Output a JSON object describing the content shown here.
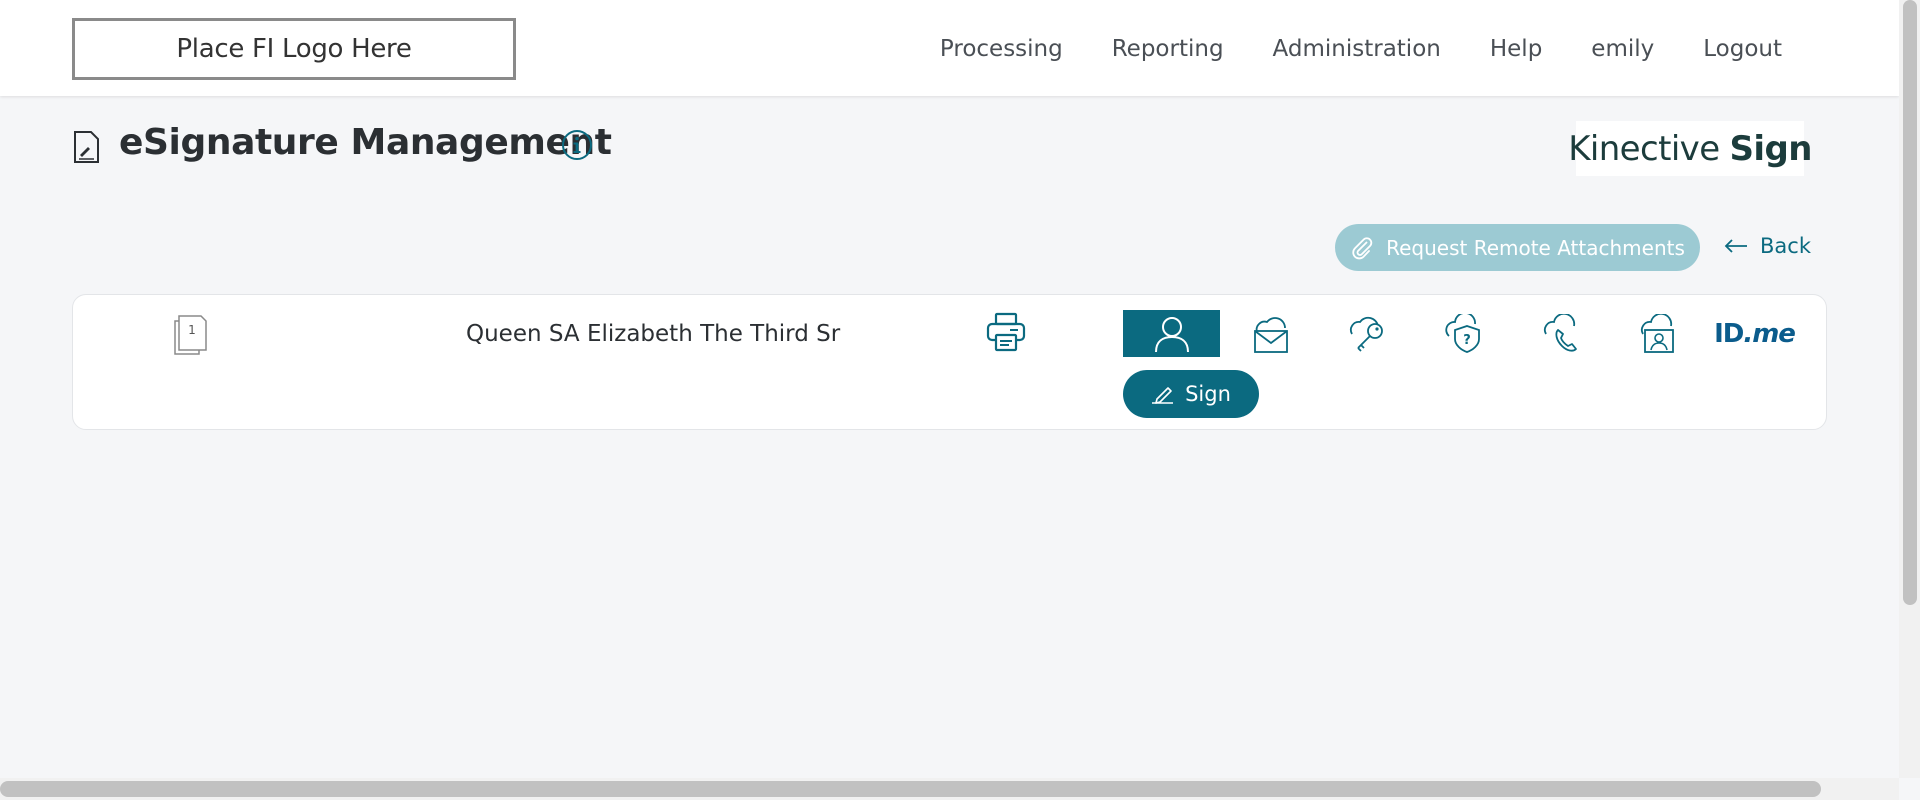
{
  "header": {
    "logo_text": "Place FI Logo Here",
    "nav": [
      "Processing",
      "Reporting",
      "Administration",
      "Help",
      "emily",
      "Logout"
    ]
  },
  "page": {
    "title": "eSignature Management",
    "title_icon": "document-sign-icon",
    "info_icon": "info-icon",
    "brand": {
      "part1": "Kinective",
      "part2": "Sign"
    }
  },
  "actions": {
    "request_attachments_label": "Request Remote Attachments",
    "request_attachments_icon": "paperclip-icon",
    "back_label": "Back",
    "back_icon": "arrow-left-icon"
  },
  "document_row": {
    "doc_count": "1",
    "signer_name": "Queen SA Elizabeth The Third Sr",
    "print_icon": "printer-icon",
    "methods": [
      {
        "icon": "in-person-icon",
        "active": true
      },
      {
        "icon": "cloud-email-icon",
        "active": false
      },
      {
        "icon": "cloud-key-icon",
        "active": false
      },
      {
        "icon": "cloud-question-shield-icon",
        "active": false
      },
      {
        "icon": "cloud-phone-icon",
        "active": false
      },
      {
        "icon": "cloud-id-card-icon",
        "active": false
      },
      {
        "icon": "idme-icon",
        "active": false,
        "text_a": "ID",
        "text_b": ".me"
      }
    ],
    "sign_label": "Sign",
    "sign_icon": "pen-icon"
  },
  "colors": {
    "accent": "#0b6a80",
    "accent_light": "#9ccad3",
    "background": "#f5f6f8",
    "idme_blue": "#0b5c8c"
  }
}
